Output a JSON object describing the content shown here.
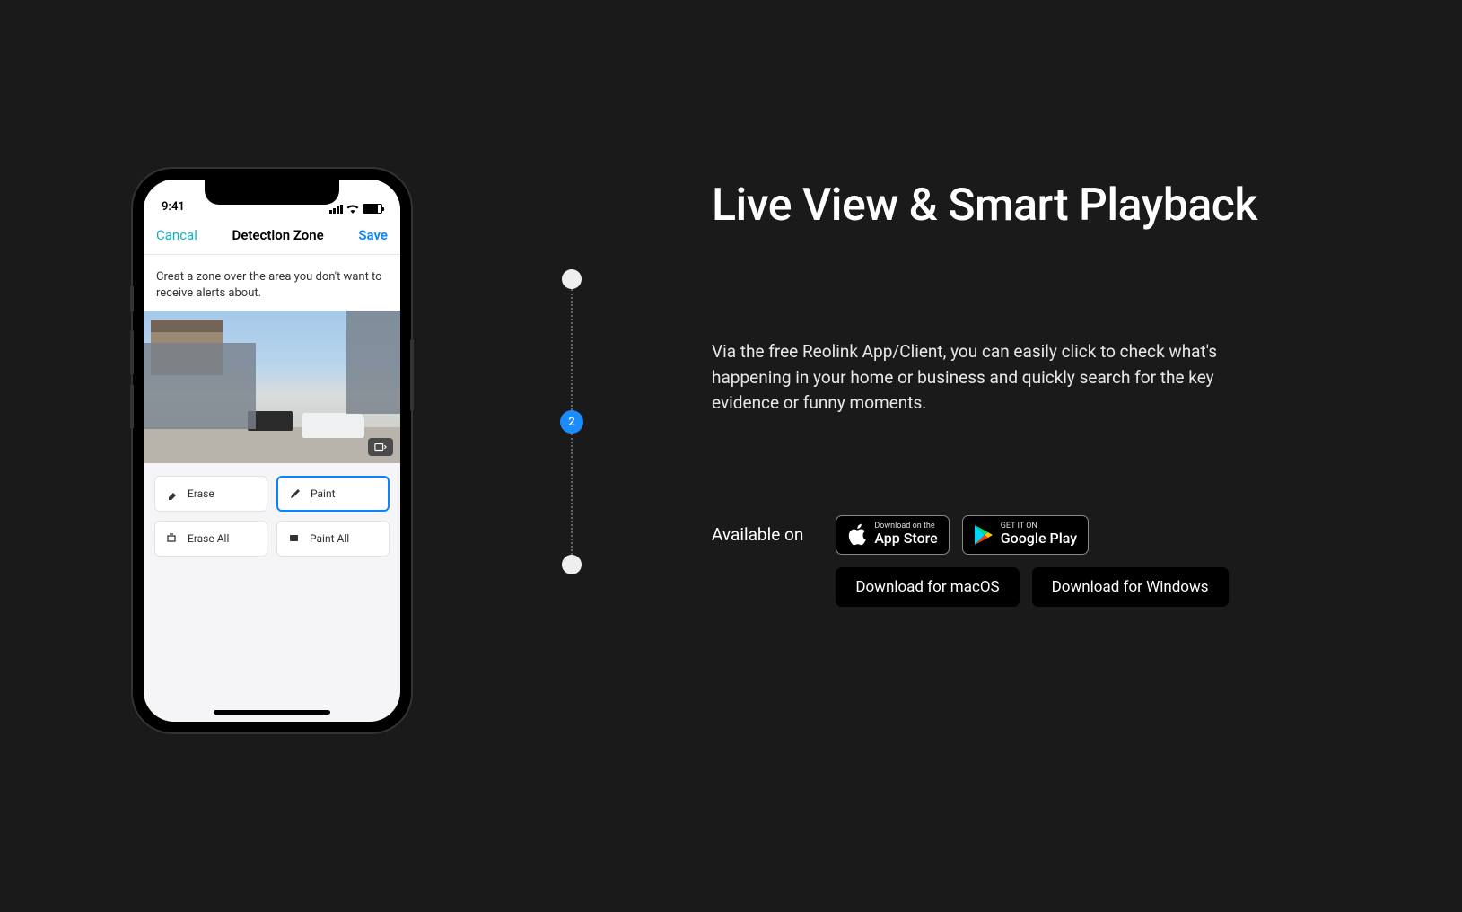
{
  "phone": {
    "statusTime": "9:41",
    "header": {
      "cancel": "Cancal",
      "title": "Detection Zone",
      "save": "Save"
    },
    "instruction": "Creat a zone over the area you don't want to receive alerts about.",
    "tools": {
      "erase": "Erase",
      "paint": "Paint",
      "eraseAll": "Erase All",
      "paintAll": "Paint All"
    }
  },
  "timeline": {
    "activeStep": "2"
  },
  "content": {
    "heading": "Live View & Smart Playback",
    "description": "Via the free Reolink App/Client, you can easily click to check what's happening in your home or business and quickly search for the key evidence or funny moments.",
    "availableLabel": "Available on",
    "appStore": {
      "small": "Download on the",
      "big": "App Store"
    },
    "googlePlay": {
      "small": "GET IT ON",
      "big": "Google Play"
    },
    "macos": "Download for macOS",
    "windows": "Download for Windows"
  }
}
